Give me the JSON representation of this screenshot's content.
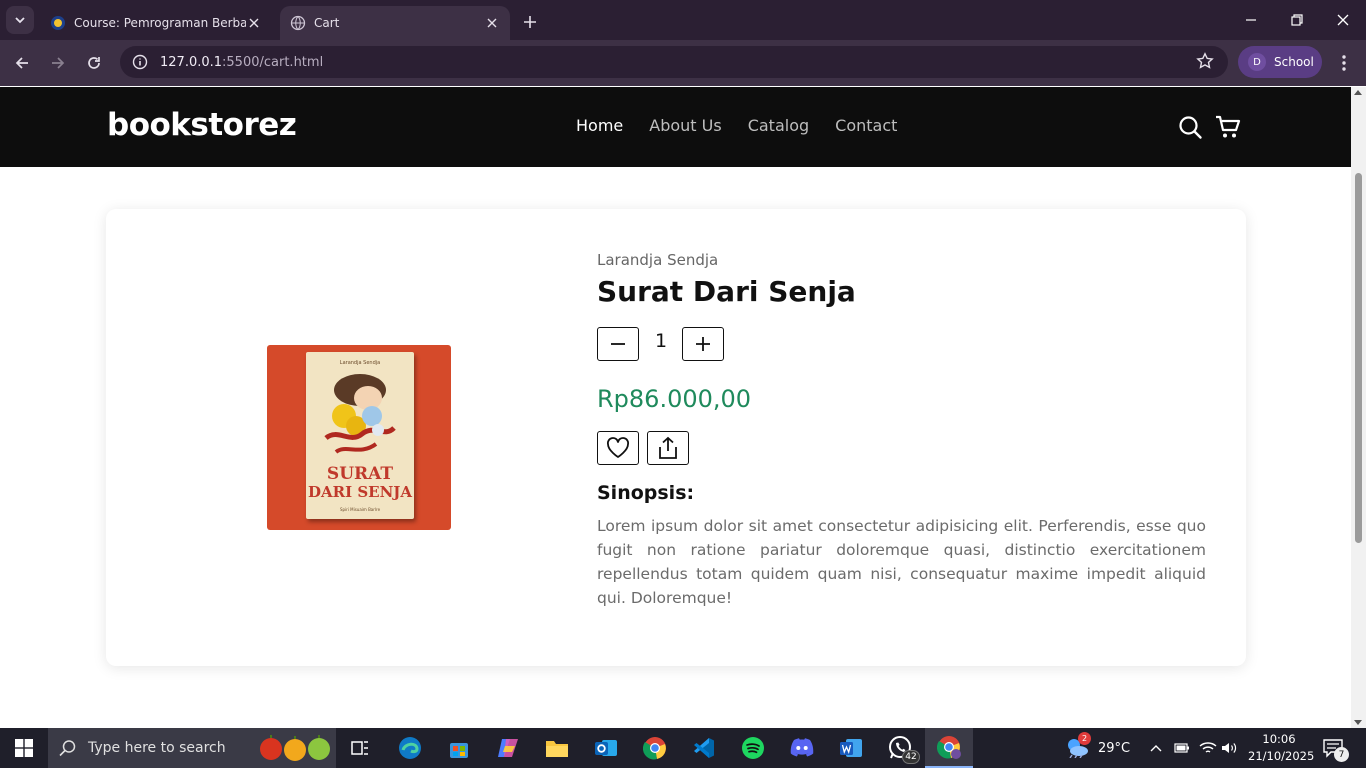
{
  "browser": {
    "tabs": [
      {
        "title": "Course: Pemrograman Berbasis",
        "active": false,
        "favicon": "university-icon"
      },
      {
        "title": "Cart",
        "active": true,
        "favicon": "globe-icon"
      }
    ],
    "url_host": "127.0.0.1",
    "url_path": ":5500/cart.html",
    "profile_initial": "D",
    "profile_name": "School"
  },
  "site": {
    "logo": "bookstorez",
    "nav": [
      "Home",
      "About Us",
      "Catalog",
      "Contact"
    ],
    "active_nav": "Home"
  },
  "product": {
    "author": "Larandja Sendja",
    "title": "Surat Dari Senja",
    "quantity": "1",
    "price": "Rp86.000,00",
    "synopsis_heading": "Sinopsis:",
    "synopsis": "Lorem ipsum dolor sit amet consectetur adipisicing elit. Perferendis, esse quo fugit non ratione pariatur doloremque quasi, distinctio exercitationem repellendus totam quidem quam nisi, consequatur maxime impedit aliquid qui. Doloremque!",
    "cover": {
      "author": "Larandja Sendja",
      "title_line1": "SURAT",
      "title_line2": "DARI SENJA",
      "subtitle": "Spiri Misuaim Barlre"
    }
  },
  "taskbar": {
    "search_placeholder": "Type here to search",
    "weather": "29°C",
    "weather_badge": "2",
    "whatsapp_badge": "42",
    "time": "10:06",
    "date": "21/10/2025",
    "notifications": "7"
  },
  "colors": {
    "header_bg": "#0d0d0d",
    "price": "#1f8a5c",
    "cover_bg": "#d54a2a",
    "chrome_tabbar": "#2b1f33",
    "chrome_toolbar": "#3d3045"
  }
}
